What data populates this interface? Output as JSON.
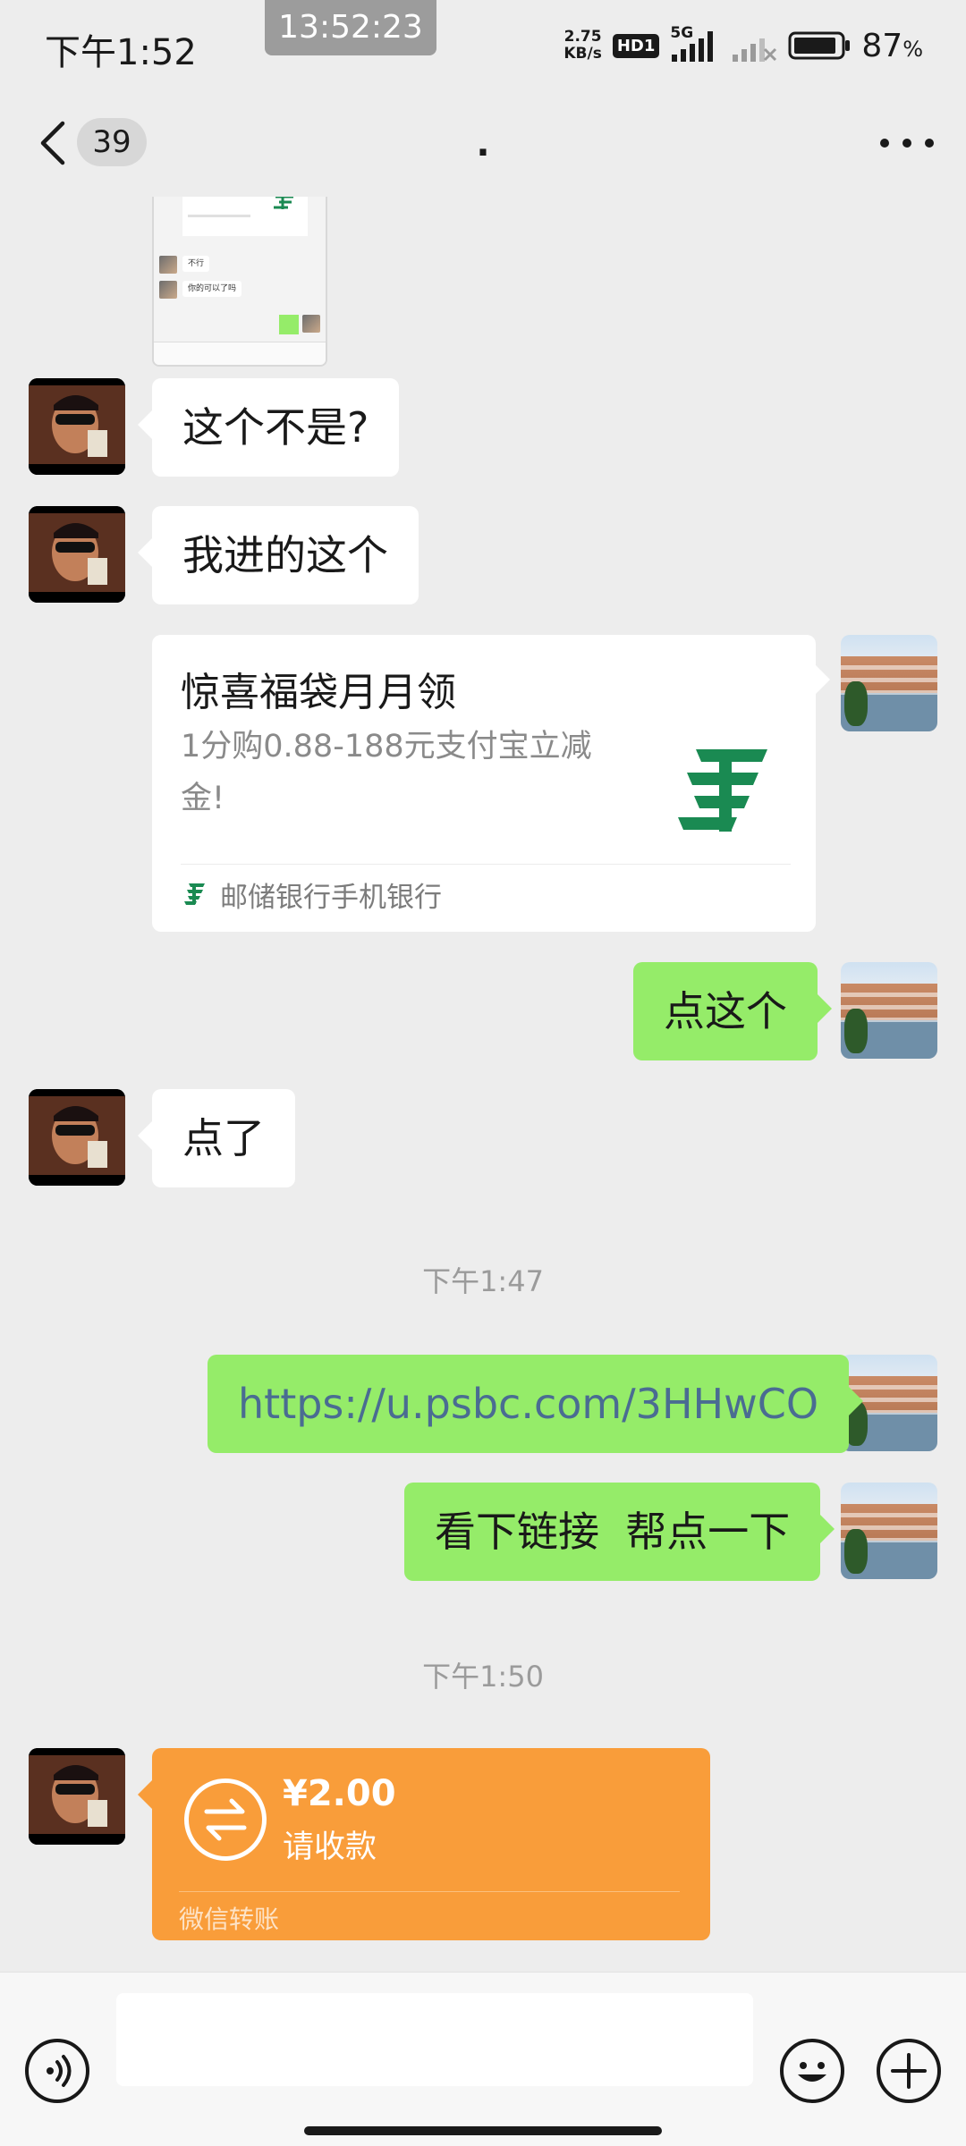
{
  "status_bar": {
    "time": "下午1:52",
    "recording_time": "13:52:23",
    "net_speed_value": "2.75",
    "net_speed_unit": "KB/s",
    "hd_badge": "HD1",
    "network_type": "5G",
    "battery_percent": "87",
    "battery_percent_unit": "%"
  },
  "nav": {
    "unread_count": "39",
    "title": "."
  },
  "messages": [
    {
      "side": "left",
      "text": "这个不是?"
    },
    {
      "side": "left",
      "text": "我进的这个"
    },
    {
      "side": "right",
      "type": "link_card",
      "title": "惊喜福袋月月领",
      "description": "1分购0.88-188元支付宝立减金!",
      "source": "邮储银行手机银行"
    },
    {
      "side": "right",
      "text": "点这个"
    },
    {
      "side": "left",
      "text": "点了"
    },
    {
      "type": "timestamp",
      "text": "下午1:47"
    },
    {
      "side": "right",
      "type": "link",
      "text": "https://u.psbc.com/3HHwCO"
    },
    {
      "side": "right",
      "text": "看下链接  帮点一下"
    },
    {
      "type": "timestamp",
      "text": "下午1:50"
    },
    {
      "side": "left",
      "type": "transfer",
      "amount": "¥2.00",
      "status": "请收款",
      "footer": "微信转账"
    }
  ],
  "screenshot_thumbnail": {
    "lines": [
      "不行",
      "你的可以了吗"
    ]
  },
  "colors": {
    "background": "#ededed",
    "self_bubble": "#95ec69",
    "other_bubble": "#ffffff",
    "transfer_card": "#f99d3a",
    "link_text": "#4a6c92",
    "psbc_logo": "#1a8a52"
  },
  "icons": {
    "back": "chevron-left-icon",
    "more": "more-horizontal-icon",
    "voice": "voice-icon",
    "emoji": "emoji-icon",
    "plus": "plus-icon",
    "transfer": "transfer-icon",
    "psbc": "psbc-logo-icon"
  }
}
